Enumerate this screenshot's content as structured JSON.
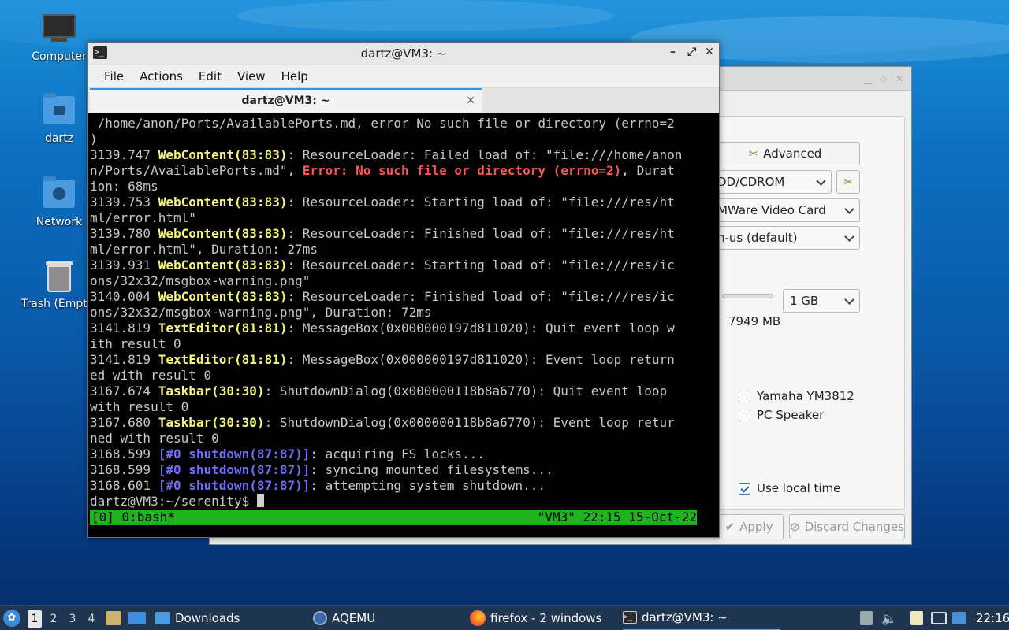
{
  "desktop": {
    "icons": [
      {
        "label": "Computer"
      },
      {
        "label": "dartz"
      },
      {
        "label": "Network"
      },
      {
        "label": "Trash (Empty)"
      }
    ]
  },
  "aqemu": {
    "advanced_label": "Advanced",
    "cdrom_combo": "DD/CDROM",
    "video_combo": "MWare Video Card",
    "keyboard_combo": "n-us (default)",
    "memory_combo": "1 GB",
    "memory_total": "7949 MB",
    "sound_yamaha": "Yamaha YM3812",
    "sound_speaker": "PC Speaker",
    "use_local_time": "Use local time",
    "apply_label": "Apply",
    "discard_label": "Discard Changes"
  },
  "terminal": {
    "window_title": "dartz@VM3: ~",
    "menu": [
      "File",
      "Actions",
      "Edit",
      "View",
      "Help"
    ],
    "tab_title": "dartz@VM3: ~",
    "prompt": "dartz@VM3:~/serenity$ ",
    "status_left": "[0] 0:bash*",
    "status_right": "\"VM3\" 22:15 15-Oct-22"
  },
  "taskbar": {
    "workspaces": [
      "1",
      "2",
      "3",
      "4"
    ],
    "tasks": [
      "Downloads",
      "AQEMU",
      "firefox - 2 windows",
      "dartz@VM3: ~"
    ],
    "clock": "22:16"
  },
  "colors": {
    "terminal_status_bg": "#1fb31f",
    "accent": "#3d8fe0"
  }
}
